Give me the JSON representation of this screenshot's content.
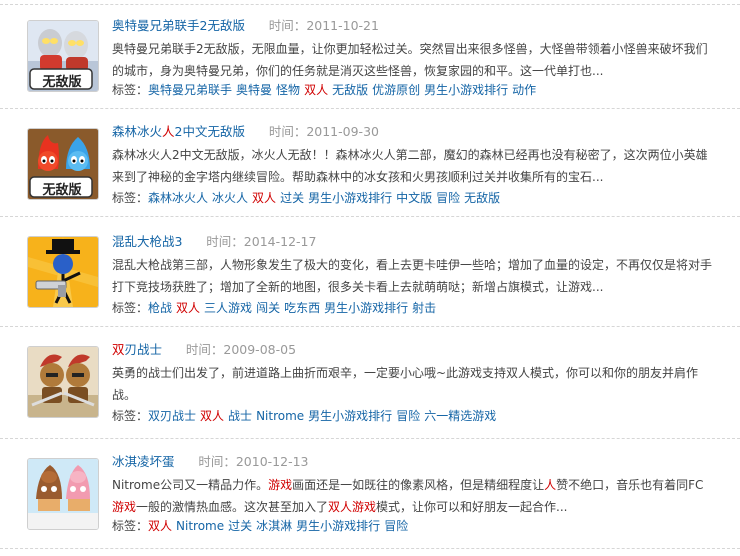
{
  "colors": {
    "link": "#1565a6",
    "highlight": "#d00000",
    "time": "#999999",
    "text": "#444444"
  },
  "time_label": "时间：",
  "tags_label": "标签：",
  "items": [
    {
      "title_a": "奥特曼兄弟联手2无敌版",
      "title_hl": "",
      "title_b": "",
      "time": "2011-10-21",
      "desc": "奥特曼兄弟联手2无敌版，无限血量，让你更加轻松过关。突然冒出来很多怪兽，大怪兽带领着小怪兽来破坏我们的城市，身为奥特曼兄弟，你们的任务就是消灭这些怪兽，恢复家园的和平。这一代单打也...",
      "tags": [
        {
          "label": "奥特曼兄弟联手",
          "hot": false
        },
        {
          "label": "奥特曼",
          "hot": false
        },
        {
          "label": "怪物",
          "hot": false
        },
        {
          "label": "双人",
          "hot": true
        },
        {
          "label": "无敌版",
          "hot": false
        },
        {
          "label": "优游原创",
          "hot": false
        },
        {
          "label": "男生小游戏排行",
          "hot": false
        },
        {
          "label": "动作",
          "hot": false
        }
      ],
      "thumb_badge": "无敌版",
      "thumb_icon": "ultraman-heroes-icon"
    },
    {
      "title_a": "森林冰火",
      "title_hl": "人",
      "title_b": "2中文无敌版",
      "time": "2011-09-30",
      "desc": "森林冰火人2中文无敌版，冰火人无敌！！森林冰火人第二部，魔幻的森林已经再也没有秘密了，这次两位小英雄来到了神秘的金字塔内继续冒险。帮助森林中的冰女孩和火男孩顺利过关并收集所有的宝石...",
      "tags": [
        {
          "label": "森林冰火人",
          "hot": false
        },
        {
          "label": "冰火人",
          "hot": false
        },
        {
          "label": "双人",
          "hot": true
        },
        {
          "label": "过关",
          "hot": false
        },
        {
          "label": "男生小游戏排行",
          "hot": false
        },
        {
          "label": "中文版",
          "hot": false
        },
        {
          "label": "冒险",
          "hot": false
        },
        {
          "label": "无敌版",
          "hot": false
        }
      ],
      "thumb_badge": "无敌版",
      "thumb_icon": "fireboy-watergirl-icon"
    },
    {
      "title_a": "混乱大枪战3",
      "title_hl": "",
      "title_b": "",
      "time": "2014-12-17",
      "desc": "混乱大枪战第三部，人物形象发生了极大的变化，看上去更卡哇伊一些哈；增加了血量的设定，不再仅仅是将对手打下竞技场获胜了；增加了全新的地图，很多关卡看上去就萌萌哒；新增占旗模式，让游戏...",
      "tags": [
        {
          "label": "枪战",
          "hot": false
        },
        {
          "label": "双人",
          "hot": true
        },
        {
          "label": "三人游戏",
          "hot": false
        },
        {
          "label": "闯关",
          "hot": false
        },
        {
          "label": "吃东西",
          "hot": false
        },
        {
          "label": "男生小游戏排行",
          "hot": false
        },
        {
          "label": "射击",
          "hot": false
        }
      ],
      "thumb_badge": "",
      "thumb_icon": "stickman-gun-icon"
    },
    {
      "title_a": "",
      "title_hl": "双",
      "title_b": "刃战士",
      "time": "2009-08-05",
      "desc": "英勇的战士们出发了，前进道路上曲折而艰辛，一定要小心哦~此游戏支持双人模式，你可以和你的朋友并肩作战。",
      "tags": [
        {
          "label": "双刃战士",
          "hot": false
        },
        {
          "label": "双人",
          "hot": true
        },
        {
          "label": "战士",
          "hot": false
        },
        {
          "label": "Nitrome",
          "hot": false
        },
        {
          "label": "男生小游戏排行",
          "hot": false
        },
        {
          "label": "冒险",
          "hot": false
        },
        {
          "label": "六一精选游戏",
          "hot": false
        }
      ],
      "thumb_badge": "",
      "thumb_icon": "spartan-warriors-icon"
    },
    {
      "title_a": "冰淇凌坏蛋",
      "title_hl": "",
      "title_b": "",
      "time": "2010-12-13",
      "desc_parts": [
        {
          "t": "Nitrome公司又一精品力作。",
          "hl": false
        },
        {
          "t": "游戏",
          "hl": true
        },
        {
          "t": "画面还是一如既往的像素风格，但是精细程度让",
          "hl": false
        },
        {
          "t": "人",
          "hl": true
        },
        {
          "t": "赞不绝口，音乐也有着同FC",
          "hl": false
        },
        {
          "t": "游戏",
          "hl": true
        },
        {
          "t": "一般的激情热血感。这次甚至加入了",
          "hl": false
        },
        {
          "t": "双人游戏",
          "hl": true
        },
        {
          "t": "模式，让你可以和好朋友一起合作...",
          "hl": false
        }
      ],
      "tags": [
        {
          "label": "双人",
          "hot": true
        },
        {
          "label": "Nitrome",
          "hot": false
        },
        {
          "label": "过关",
          "hot": false
        },
        {
          "label": "冰淇淋",
          "hot": false
        },
        {
          "label": "男生小游戏排行",
          "hot": false
        },
        {
          "label": "冒险",
          "hot": false
        }
      ],
      "thumb_badge": "",
      "thumb_icon": "bad-ice-cream-icon"
    }
  ]
}
